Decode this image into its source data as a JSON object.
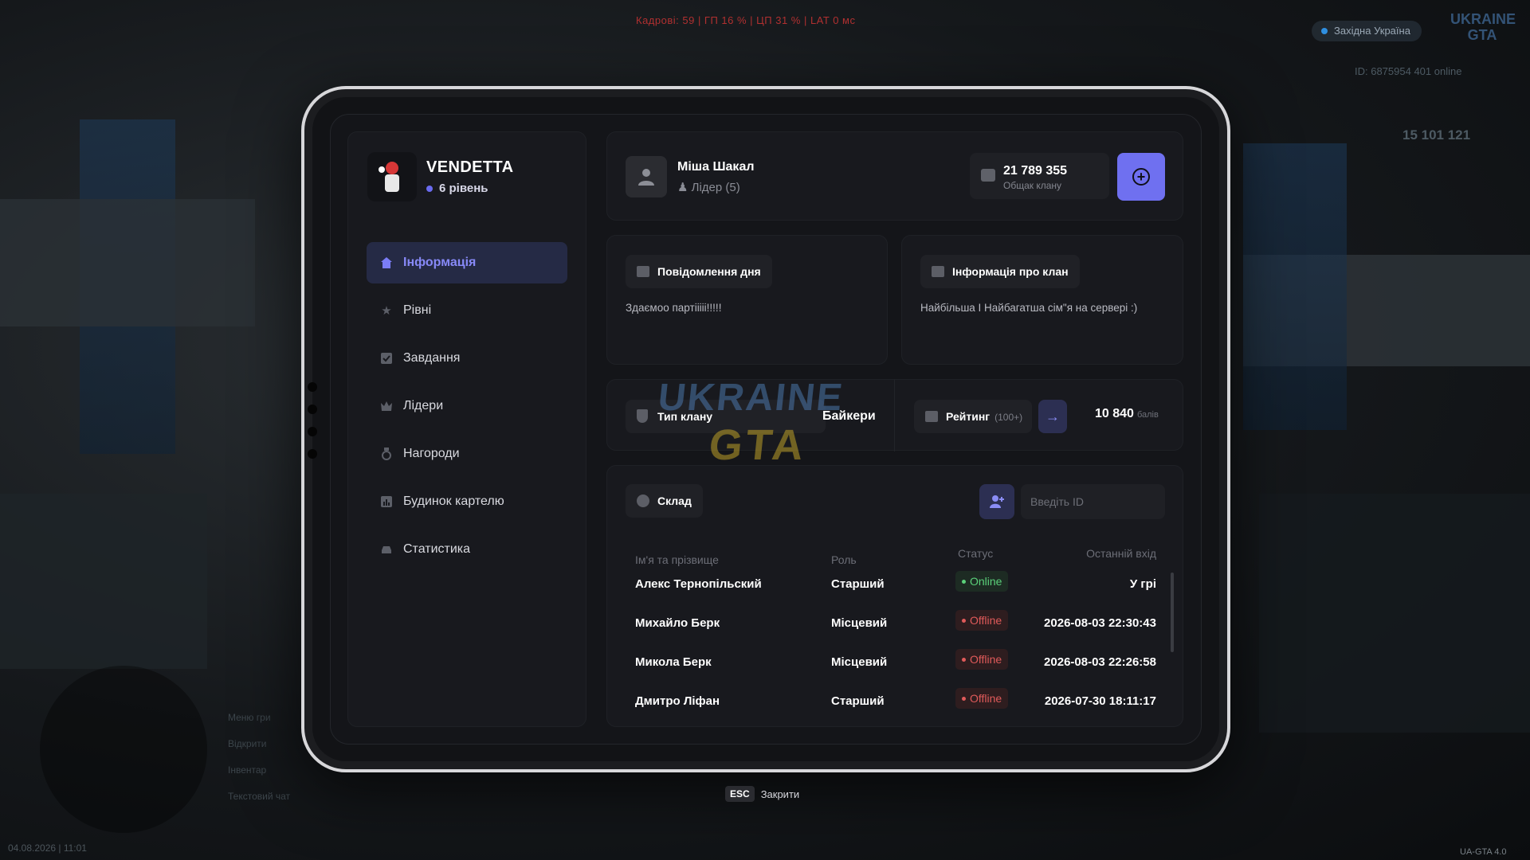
{
  "hud": {
    "perf_line": "Кадрові: 59  |  ГП 16 %  |  ЦП 31 %  |  LAT 0 мс",
    "server_name": "Західна Україна",
    "logo_text": "UKRAINE GTA",
    "player_id": "ID: 6875954   401 online",
    "money": "15 101 121",
    "datetime": "04.08.2026 | 11:01",
    "version": "UA-GTA 4.0",
    "hotkeys": [
      "Меню гри",
      "Відкрити",
      "Інвентар",
      "Текстовий чат"
    ]
  },
  "clan": {
    "name": "VENDETTA",
    "level": "6 рівень"
  },
  "nav": {
    "items": [
      {
        "label": "Інформація",
        "icon": "home-icon",
        "active": true
      },
      {
        "label": "Рівні",
        "icon": "star-icon",
        "active": false
      },
      {
        "label": "Завдання",
        "icon": "checkbox-icon",
        "active": false
      },
      {
        "label": "Лідери",
        "icon": "crown-icon",
        "active": false
      },
      {
        "label": "Нагороди",
        "icon": "medal-icon",
        "active": false
      },
      {
        "label": "Будинок картелю",
        "icon": "chart-icon",
        "active": false
      },
      {
        "label": "Статистика",
        "icon": "car-icon",
        "active": false
      }
    ]
  },
  "profile": {
    "name": "Міша Шакал",
    "role": "Лідер (5)",
    "bank_amount": "21 789 355",
    "bank_label": "Общак клану"
  },
  "message_of_day": {
    "title": "Повідомлення дня",
    "text": "Здаємоо партііііі!!!!!"
  },
  "clan_info": {
    "title": "Інформація про клан",
    "text": "Найбільша І Найбагатша сім\"я на сервері :)"
  },
  "clan_type": {
    "label": "Тип клану",
    "value": "Байкери"
  },
  "rating": {
    "label": "Рейтинг",
    "sub": "(100+)",
    "value": "10 840",
    "unit": "балів"
  },
  "roster": {
    "title": "Склад",
    "search_placeholder": "Введіть ID",
    "columns": [
      "Ім'я та прізвище",
      "Роль",
      "Статус",
      "Останній вхід"
    ],
    "rows": [
      {
        "name": "Алекс Тернопільский",
        "role": "Старший",
        "status": "Online",
        "last": "У грі"
      },
      {
        "name": "Михайло Берк",
        "role": "Місцевий",
        "status": "Offline",
        "last": "2026-08-03 22:30:43"
      },
      {
        "name": "Микола Берк",
        "role": "Місцевий",
        "status": "Offline",
        "last": "2026-08-03 22:26:58"
      },
      {
        "name": "Дмитро Ліфан",
        "role": "Старший",
        "status": "Offline",
        "last": "2026-07-30 18:11:17"
      }
    ]
  },
  "close_hint": {
    "key": "ESC",
    "label": "Закрити"
  },
  "colors": {
    "accent": "#6f70f0",
    "online": "#5bd07a",
    "offline": "#e05a5a"
  }
}
